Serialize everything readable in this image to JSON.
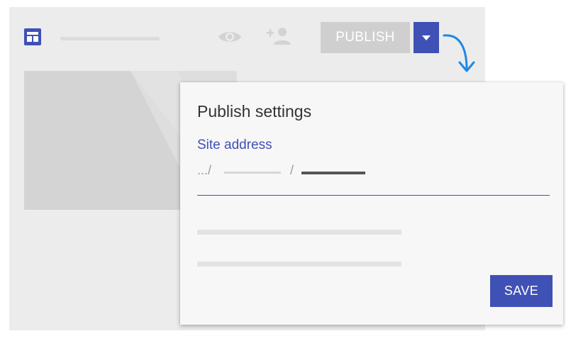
{
  "toolbar": {
    "logo_icon": "web-layout-icon",
    "preview_icon": "eye-icon",
    "share_icon": "person-add-icon",
    "publish_label": "PUBLISH",
    "publish_dropdown_icon": "caret-down-icon"
  },
  "dialog": {
    "title": "Publish settings",
    "field_label": "Site address",
    "address_prefix": ".../",
    "address_separator": "/",
    "save_label": "SAVE"
  },
  "colors": {
    "accent": "#3f51b5",
    "window_bg": "#ececec",
    "dialog_bg": "#f7f7f7",
    "publish_inactive": "#cfcfcf",
    "arrow": "#1e88e5"
  }
}
